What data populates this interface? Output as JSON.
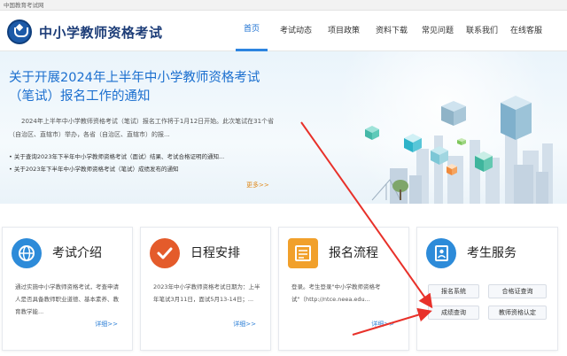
{
  "topbar": {
    "text": "中国教育考试网"
  },
  "header": {
    "site_title": "中小学教师资格考试"
  },
  "nav": [
    {
      "label": "首页",
      "active": true
    },
    {
      "label": "考试动态"
    },
    {
      "label": "项目政策"
    },
    {
      "label": "资料下载"
    },
    {
      "label": "常见问题"
    },
    {
      "label": "联系我们"
    },
    {
      "label": "在线客服"
    }
  ],
  "banner": {
    "title": "关于开展2024年上半年中小学教师资格考试（笔试）报名工作的通知",
    "desc": "2024年上半年中小学教师资格考试（笔试）报名工作将于1月12日开始。此次笔试在31个省（自治区、直辖市）举办，各省（自治区、直辖市）的报...",
    "list": [
      "关于查询2023年下半年中小学教师资格考试（面试）结果、考试合格证明的通知...",
      "关于2023年下半年中小学教师资格考试（笔试）成绩发布的通知"
    ],
    "more": "更多>>"
  },
  "cards": {
    "intro": {
      "title": "考试介绍",
      "text": "通过实施中小学教师资格考试，考查申请人是否具备教师职业道德、基本素养、教育教学能...",
      "more": "详细>>"
    },
    "schedule": {
      "title": "日程安排",
      "text": "2023年中小学教师资格考试日期为：上半年笔试3月11日，面试5月13-14日；...",
      "more": "详细>>"
    },
    "process": {
      "title": "报名流程",
      "text": "登录。考生登录\"中小学教师资格考试\"（http://ntce.neea.edu...",
      "more": "详细>>"
    },
    "service": {
      "title": "考生服务",
      "buttons": [
        "报名系统",
        "合格证查询",
        "成绩查询",
        "教师资格认定"
      ]
    }
  },
  "colors": {
    "accent": "#1b6fcf",
    "nav_active": "#2d84e0",
    "arrow": "#e8312a"
  }
}
